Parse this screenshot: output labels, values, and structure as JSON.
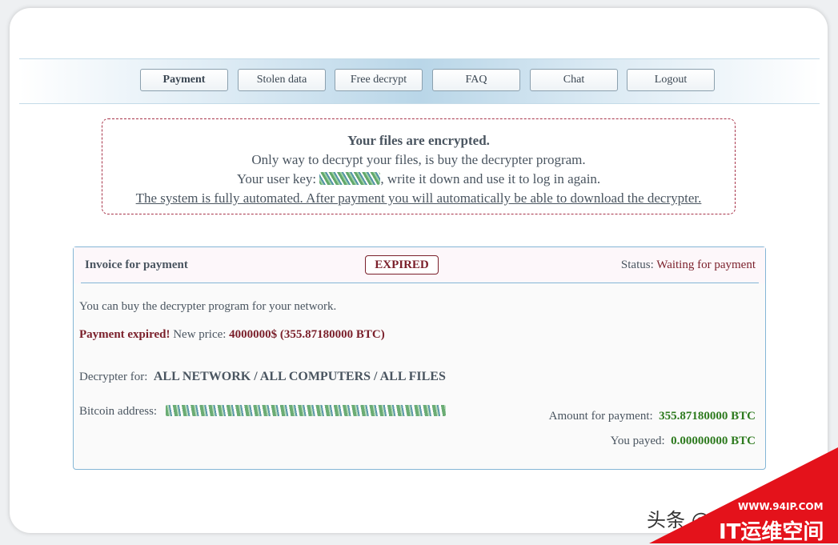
{
  "nav": {
    "items": [
      {
        "label": "Payment"
      },
      {
        "label": "Stolen data"
      },
      {
        "label": "Free decrypt"
      },
      {
        "label": "FAQ"
      },
      {
        "label": "Chat"
      },
      {
        "label": "Logout"
      }
    ]
  },
  "notice": {
    "title": "Your files are encrypted.",
    "line1": "Only way to decrypt your files, is buy the decrypter program.",
    "key_prefix": "Your user key:",
    "key_suffix": ", write it down and use it to log in again.",
    "automated": "The system is fully automated. After payment you will automatically be able to download the decrypter."
  },
  "invoice": {
    "title": "Invoice for payment",
    "badge": "EXPIRED",
    "status_label": "Status:",
    "status_value": "Waiting for payment",
    "buy_text": "You can buy the decrypter program for your network.",
    "expired_label": "Payment expired!",
    "new_price_label": "New price:",
    "new_price_value": "4000000$",
    "new_price_btc": "(355.87180000 BTC)",
    "decrypter_label": "Decrypter for:",
    "decrypter_value": "ALL NETWORK / ALL COMPUTERS / ALL FILES",
    "bitcoin_label": "Bitcoin address:",
    "amount_label": "Amount for payment:",
    "amount_value": "355.87180000 BTC",
    "payed_label": "You payed:",
    "payed_value": "0.00000000 BTC"
  },
  "watermark": {
    "text": "头条 @",
    "url": "WWW.94IP.COM",
    "brand": "IT运维空间"
  },
  "colors": {
    "accent_red": "#7a1f2a",
    "accent_green": "#2d7a1e",
    "border_blue": "#84b6d6",
    "dashed_red": "#a8344a",
    "watermark_red": "#e4121b"
  }
}
